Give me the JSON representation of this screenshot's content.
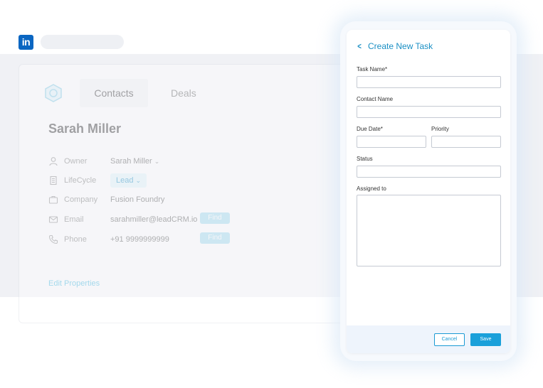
{
  "browser": {
    "logo_text": "in"
  },
  "crm": {
    "tabs": [
      "Contacts",
      "Deals"
    ],
    "contact_name": "Sarah Miller",
    "properties": {
      "owner": {
        "label": "Owner",
        "value": "Sarah Miller"
      },
      "lifecycle": {
        "label": "LifeCycle",
        "value": "Lead"
      },
      "company": {
        "label": "Company",
        "value": "Fusion Foundry"
      },
      "email": {
        "label": "Email",
        "value": "sarahmiller@leadCRM.io",
        "action": "Find"
      },
      "phone": {
        "label": "Phone",
        "value": "+91 9999999999",
        "action": "Find"
      }
    },
    "edit_properties": "Edit Properties"
  },
  "task_panel": {
    "title": "Create New Task",
    "fields": {
      "task_name": {
        "label": "Task Name*",
        "value": ""
      },
      "contact_name": {
        "label": "Contact Name",
        "value": ""
      },
      "due_date": {
        "label": "Due Date*",
        "value": ""
      },
      "priority": {
        "label": "Priority",
        "value": ""
      },
      "status": {
        "label": "Status",
        "value": ""
      },
      "assigned_to": {
        "label": "Assigned to",
        "value": ""
      }
    },
    "cancel_label": "Cancel",
    "save_label": "Save"
  },
  "colors": {
    "accent": "#1a9ad4",
    "linkedin": "#0a66c2"
  }
}
